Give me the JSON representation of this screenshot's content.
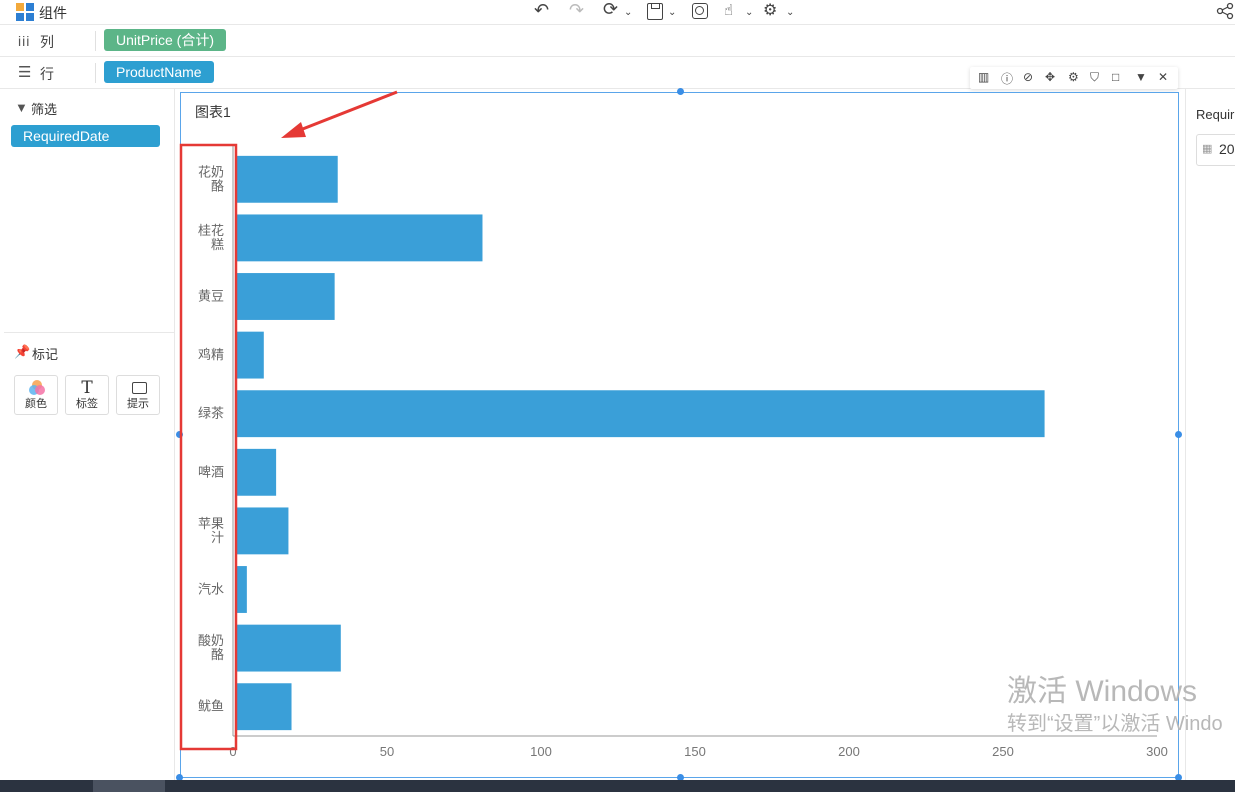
{
  "toolbar": {
    "components_label": "组件",
    "undo_icon": "undo-icon",
    "redo_icon": "redo-icon",
    "refresh_icon": "refresh-icon",
    "save_icon": "save-icon",
    "preview_icon": "preview-icon",
    "hand_icon": "hand-icon",
    "settings_icon": "gear-icon",
    "share_icon": "share-icon"
  },
  "shelves": {
    "columns_label": "列",
    "columns_pill": "UnitPrice (合计)",
    "rows_label": "行",
    "rows_pill": "ProductName"
  },
  "filter": {
    "title": "筛选",
    "pill": "RequiredDate"
  },
  "marks": {
    "title": "标记",
    "buttons": [
      "颜色",
      "标签",
      "提示"
    ]
  },
  "right_panel": {
    "title": "Requir",
    "date_value": "20"
  },
  "watermark": {
    "line1": "激活 Windows",
    "line2": "转到“设置”以激活 Windo"
  },
  "colors": {
    "bar": "#3a9fd8",
    "pill_green": "#5cb588",
    "pill_blue": "#2d9fd1",
    "selection": "#5aa5ea",
    "highlight": "#e53935"
  },
  "chart_data": {
    "type": "bar",
    "orientation": "horizontal",
    "title": "图表1",
    "categories": [
      "花奶酪",
      "桂花糕",
      "黄豆",
      "鸡精",
      "绿茶",
      "啤酒",
      "苹果汁",
      "汽水",
      "酸奶酪",
      "鱿鱼"
    ],
    "category_labels": [
      [
        "花奶",
        "酪"
      ],
      [
        "桂花",
        "糕"
      ],
      [
        "黄豆"
      ],
      [
        "鸡精"
      ],
      [
        "绿茶"
      ],
      [
        "啤酒"
      ],
      [
        "苹果",
        "汁"
      ],
      [
        "汽水"
      ],
      [
        "酸奶",
        "酪"
      ],
      [
        "鱿鱼"
      ]
    ],
    "values": [
      34,
      81,
      33,
      10,
      263.5,
      14,
      18,
      4.5,
      35,
      19
    ],
    "xlim": [
      0,
      300
    ],
    "xticks": [
      0,
      50,
      100,
      150,
      200,
      250,
      300
    ],
    "grid": false
  }
}
